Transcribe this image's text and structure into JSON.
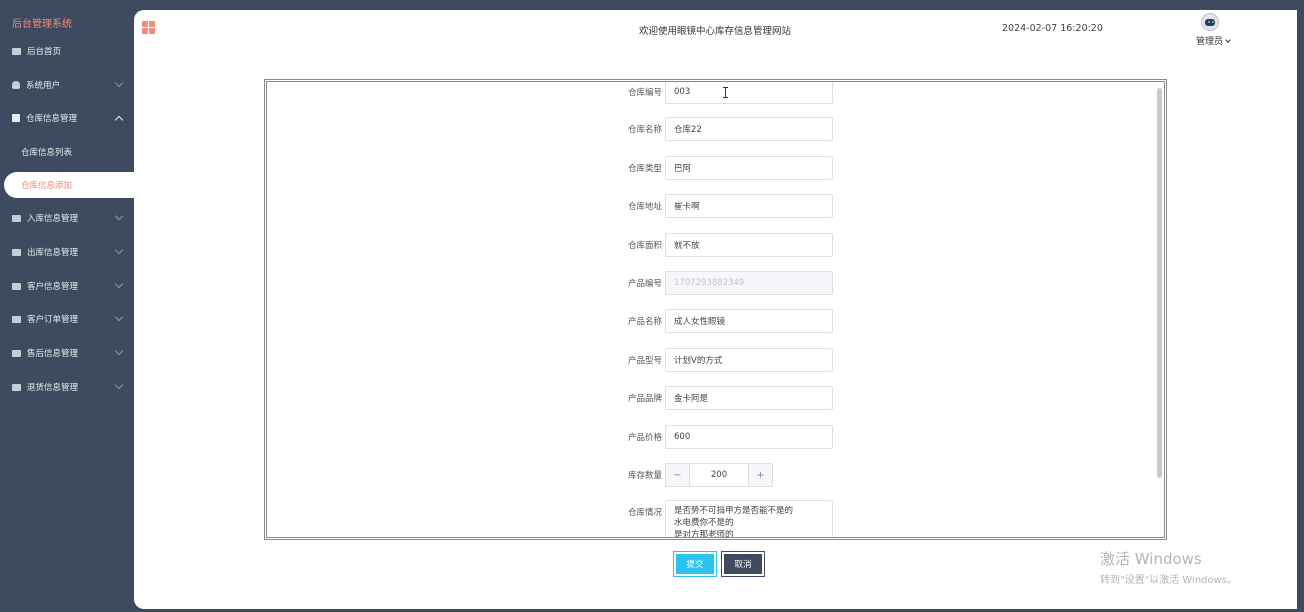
{
  "brand": "后台管理系统",
  "menu": {
    "home": "后台首页",
    "users": "系统用户",
    "warehouse": "仓库信息管理",
    "warehouse_sub": [
      "仓库信息列表",
      "仓库信息添加"
    ],
    "inbound": "入库信息管理",
    "outbound": "出库信息管理",
    "customers": "客户信息管理",
    "orders": "客户订单管理",
    "aftersales": "售后信息管理",
    "returns": "退货信息管理"
  },
  "header": {
    "welcome": "欢迎使用眼镜中心库存信息管理网站",
    "datetime": "2024-02-07 16:20:20",
    "user": "管理员"
  },
  "form": {
    "fields": [
      {
        "label": "仓库编号",
        "value": "003"
      },
      {
        "label": "仓库名称",
        "value": "仓库22"
      },
      {
        "label": "仓库类型",
        "value": "巴阿"
      },
      {
        "label": "仓库地址",
        "value": "崔卡啊"
      },
      {
        "label": "仓库面积",
        "value": "就不放"
      },
      {
        "label": "产品编号",
        "value": "1707293882349"
      },
      {
        "label": "产品名称",
        "value": "成人女性眼镜"
      },
      {
        "label": "产品型号",
        "value": "计划V的方式"
      },
      {
        "label": "产品品牌",
        "value": "金卡阿是"
      },
      {
        "label": "产品价格",
        "value": "600"
      }
    ],
    "stock": {
      "label": "库存数量",
      "value": "200",
      "minus": "−",
      "plus": "+"
    },
    "condition": {
      "label": "仓库情况",
      "lines": [
        "是否势不可挡甲方是否能不是的",
        "水电费你不是的",
        "是对方那老师的"
      ]
    },
    "submit": "提交",
    "cancel": "取消"
  },
  "watermark": {
    "line1": "激活 Windows",
    "line2": "转到\"设置\"以激活 Windows。"
  }
}
